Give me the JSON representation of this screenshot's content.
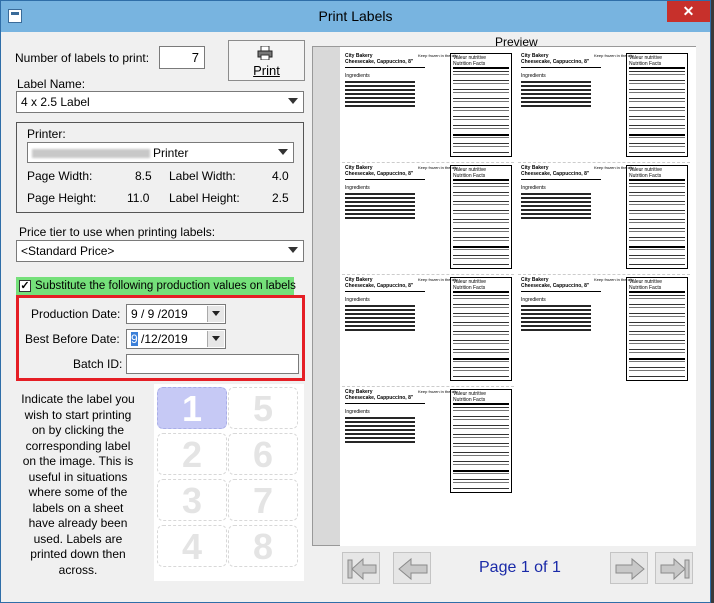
{
  "window": {
    "title": "Print Labels",
    "close": "✕"
  },
  "labels_count": {
    "label": "Number of labels to print:",
    "value": "7"
  },
  "print_button": {
    "label": "Print"
  },
  "label_name": {
    "label": "Label Name:",
    "value": "4 x 2.5 Label"
  },
  "printer_group": {
    "label": "Printer:",
    "printer_suffix": "Printer",
    "page_width_label": "Page Width:",
    "page_width": "8.5",
    "label_width_label": "Label Width:",
    "label_width": "4.0",
    "page_height_label": "Page Height:",
    "page_height": "11.0",
    "label_height_label": "Label Height:",
    "label_height": "2.5"
  },
  "price_tier": {
    "label": "Price tier to use when printing labels:",
    "value": "<Standard Price>"
  },
  "substitute": {
    "label": "Substitute the following production values on labels",
    "checked": true
  },
  "production_date": {
    "label": "Production Date:",
    "value": "9 / 9 /2019"
  },
  "best_before": {
    "label": "Best Before Date:",
    "highlight": "9",
    "rest": " /12/2019"
  },
  "batch_id": {
    "label": "Batch ID:",
    "value": ""
  },
  "instructions": [
    "Indicate the label you",
    "wish to start printing",
    "on by clicking the",
    "corresponding label",
    "on the image. This is",
    "useful in situations",
    "where some of the",
    "labels on a sheet",
    "have already been",
    "used. Labels are",
    "printed down then",
    "across."
  ],
  "sheet_slots": [
    "1",
    "2",
    "3",
    "4",
    "5",
    "6",
    "7",
    "8"
  ],
  "preview": {
    "title": "Preview",
    "label_line1": "City Bakery",
    "label_line2": "Cheesecake, Cappuccino, 8\"",
    "label_note": "Keep frozen in the city",
    "ingredients": "Ingredients",
    "nf_title1": "Valeur nutritive",
    "nf_title2": "Nutrition Facts"
  },
  "page_indicator": "Page 1 of 1"
}
